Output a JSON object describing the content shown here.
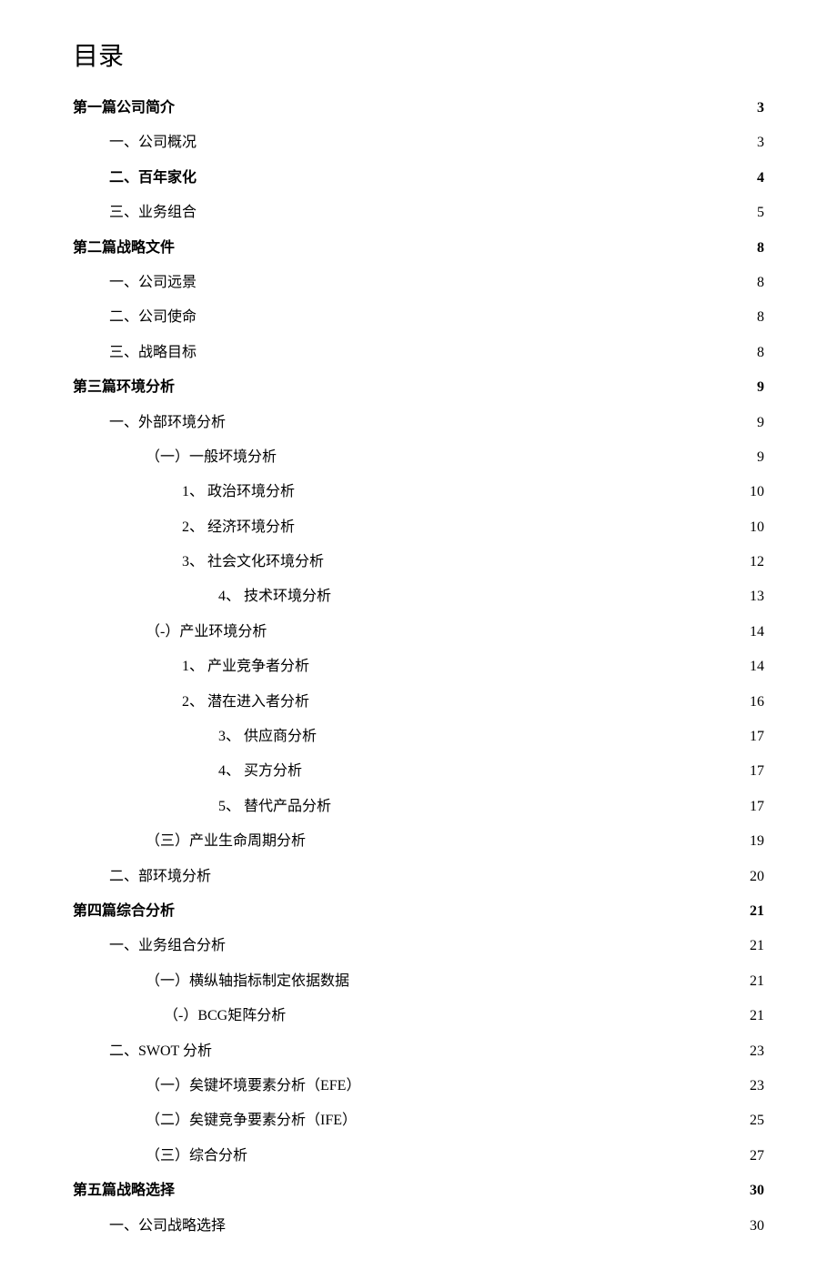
{
  "title": "目录",
  "entries": [
    {
      "label": "第一篇公司简介",
      "page": "3",
      "indent": "indent-0",
      "bold": true
    },
    {
      "label": "一、公司概况",
      "page": "3",
      "indent": "indent-1",
      "bold": false
    },
    {
      "label": "二、百年家化",
      "page": "4",
      "indent": "indent-1",
      "bold": true
    },
    {
      "label": "三、业务组合",
      "page": "5",
      "indent": "indent-1",
      "bold": false
    },
    {
      "label": "第二篇战略文件",
      "page": "8",
      "indent": "indent-0",
      "bold": true
    },
    {
      "label": "一、公司远景",
      "page": "8",
      "indent": "indent-1",
      "bold": false
    },
    {
      "label": "二、公司使命",
      "page": "8",
      "indent": "indent-1",
      "bold": false
    },
    {
      "label": "三、战略目标",
      "page": "8",
      "indent": "indent-1",
      "bold": false
    },
    {
      "label": "第三篇环境分析",
      "page": "9",
      "indent": "indent-0",
      "bold": true
    },
    {
      "label": "一、外部环境分析",
      "page": "9",
      "indent": "indent-1",
      "bold": false
    },
    {
      "label": "（一）一般坏境分析",
      "page": "9",
      "indent": "indent-2",
      "bold": false
    },
    {
      "label": "1、 政治环境分析",
      "page": "10",
      "indent": "indent-3",
      "bold": false
    },
    {
      "label": "2、 经济环境分析",
      "page": "10",
      "indent": "indent-3",
      "bold": false
    },
    {
      "label": "3、 社会文化环境分析",
      "page": "12",
      "indent": "indent-3",
      "bold": false
    },
    {
      "label": "4、 技术环境分析",
      "page": "13",
      "indent": "indent-4",
      "bold": false
    },
    {
      "label": "（-）产业环境分析",
      "page": "14",
      "indent": "indent-2",
      "bold": false
    },
    {
      "label": "1、 产业竞争者分析",
      "page": "14",
      "indent": "indent-3",
      "bold": false
    },
    {
      "label": "2、 潜在进入者分析",
      "page": "16",
      "indent": "indent-3",
      "bold": false
    },
    {
      "label": "3、 供应商分析",
      "page": "17",
      "indent": "indent-4",
      "bold": false
    },
    {
      "label": "4、 买方分析",
      "page": "17",
      "indent": "indent-4",
      "bold": false
    },
    {
      "label": "5、 替代产品分析",
      "page": "17",
      "indent": "indent-4",
      "bold": false
    },
    {
      "label": "（三）产业生命周期分析",
      "page": "19",
      "indent": "indent-2",
      "bold": false
    },
    {
      "label": "二、部环境分析",
      "page": "20",
      "indent": "indent-1",
      "bold": false
    },
    {
      "label": "第四篇综合分析",
      "page": "21",
      "indent": "indent-0",
      "bold": true
    },
    {
      "label": "一、业务组合分析",
      "page": "21",
      "indent": "indent-1",
      "bold": false
    },
    {
      "label": "（一）横纵轴指标制定依据数据",
      "page": "21",
      "indent": "indent-2",
      "bold": false
    },
    {
      "label": "（-）BCG矩阵分析",
      "page": "21",
      "indent": "indent-2b",
      "bold": false
    },
    {
      "label": "二、SWOT 分析",
      "page": "23",
      "indent": "indent-1",
      "bold": false
    },
    {
      "label": "（一）矣键坏境要素分析（EFE）",
      "page": "23",
      "indent": "indent-2",
      "bold": false
    },
    {
      "label": "（二）矣键竞争要素分析（IFE）",
      "page": "25",
      "indent": "indent-2",
      "bold": false
    },
    {
      "label": "（三）综合分析",
      "page": "27",
      "indent": "indent-2",
      "bold": false
    },
    {
      "label": "第五篇战略选择",
      "page": "30",
      "indent": "indent-0",
      "bold": true
    },
    {
      "label": "一、公司战略选择",
      "page": "30",
      "indent": "indent-1",
      "bold": false
    }
  ]
}
